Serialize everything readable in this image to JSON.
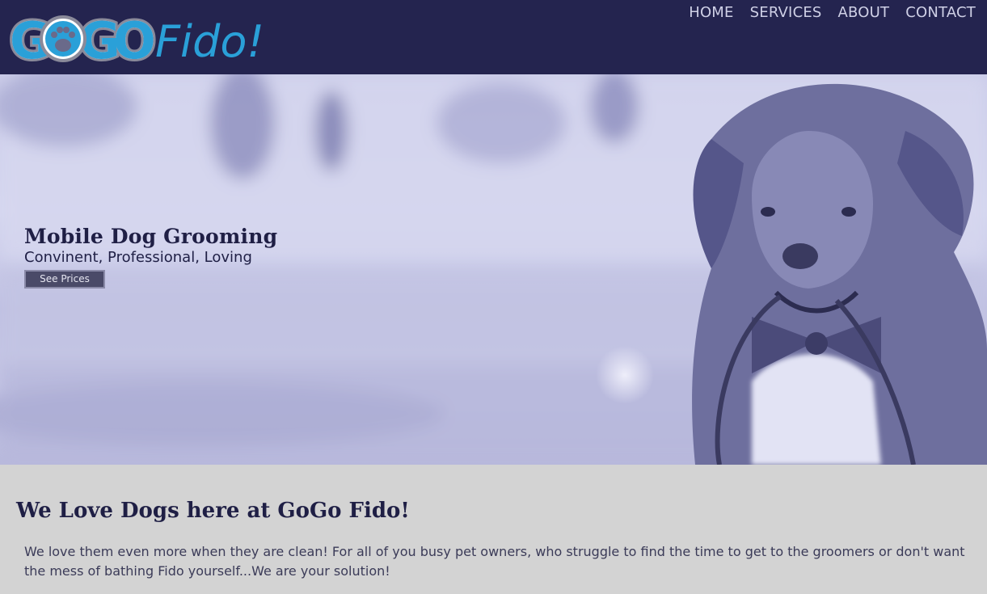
{
  "header": {
    "logo_text_a": "GOGO",
    "logo_text_b": "Fido!",
    "nav": [
      {
        "label": "HOME"
      },
      {
        "label": "SERVICES"
      },
      {
        "label": "ABOUT"
      },
      {
        "label": "CONTACT"
      }
    ]
  },
  "hero": {
    "title": "Mobile Dog Grooming",
    "subtitle": "Convinent, Professional, Loving",
    "cta_label": "See Prices"
  },
  "intro": {
    "heading": "We Love Dogs here at GoGo Fido!",
    "body": "We love them even more when they are clean! For all of you busy pet owners, who struggle to find the time to get to the groomers or don't want the mess of bathing Fido yourself...We are your solution!"
  },
  "colors": {
    "header_bg": "#24244f",
    "hero_tint": "#c9cae8",
    "section_bg": "#d3d3d3",
    "logo_blue": "#2aa0d8"
  },
  "icons": {
    "logo_paw": "paw-icon"
  }
}
